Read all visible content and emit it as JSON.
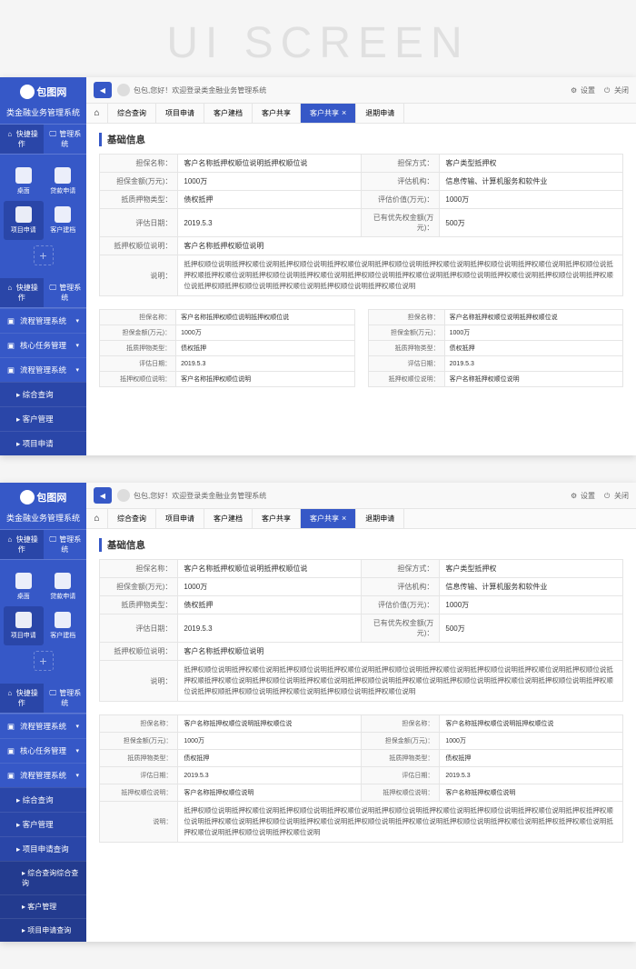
{
  "watermark": "UI SCREEN",
  "sidebar": {
    "logo_text": "包图网",
    "subtitle": "类金融业务管理系统",
    "tabs": [
      {
        "label": "快捷操作",
        "active": true
      },
      {
        "label": "管理系统",
        "active": false
      }
    ],
    "quick_items": [
      {
        "label": "桌面"
      },
      {
        "label": "贷款申请"
      },
      {
        "label": "项目申请",
        "active": true
      },
      {
        "label": "客户建档"
      }
    ],
    "nav_screen1": [
      {
        "label": "流程管理系统",
        "arrow": "▾"
      },
      {
        "label": "核心任务管理",
        "arrow": "▾"
      },
      {
        "label": "流程管理系统",
        "arrow": "▾",
        "expanded": true
      },
      {
        "label": "综合查询",
        "indented": true
      },
      {
        "label": "客户管理",
        "indented": true
      },
      {
        "label": "项目申请",
        "indented": true
      }
    ],
    "nav_screen2": [
      {
        "label": "流程管理系统",
        "arrow": "▾"
      },
      {
        "label": "核心任务管理",
        "arrow": "▾"
      },
      {
        "label": "流程管理系统",
        "arrow": "▾",
        "expanded": true
      },
      {
        "label": "综合查询",
        "indented": true
      },
      {
        "label": "客户管理",
        "indented": true
      },
      {
        "label": "项目申请查询",
        "indented": true
      },
      {
        "label": "综合查询综合查询",
        "sub_indented": true
      },
      {
        "label": "客户管理",
        "sub_indented": true
      },
      {
        "label": "项目申请查询",
        "sub_indented": true
      }
    ]
  },
  "topbar": {
    "welcome": "包包,您好！欢迎登录类金融业务管理系统",
    "settings": "设置",
    "close": "关闭"
  },
  "tabs": [
    {
      "label": "综合查询"
    },
    {
      "label": "项目申请"
    },
    {
      "label": "客户建档"
    },
    {
      "label": "客户共享"
    },
    {
      "label": "客户共享",
      "active": true,
      "closable": true
    },
    {
      "label": "退期申请"
    }
  ],
  "section": {
    "title": "基础信息",
    "rows": [
      {
        "l1": "担保名称：",
        "v1": "客户名称抵押权顺位说明抵押权顺位说",
        "l2": "担保方式：",
        "v2": "客户类型抵押权"
      },
      {
        "l1": "担保金额(万元)：",
        "v1": "1000万",
        "l2": "评估机构：",
        "v2": "信息传输、计算机服务和软件业"
      },
      {
        "l1": "抵质押物类型：",
        "v1": "债权抵押",
        "l2": "评估价值(万元)：",
        "v2": "1000万"
      },
      {
        "l1": "评估日期：",
        "v1": "2019.5.3",
        "l2": "已有优先权金额(万元)：",
        "v2": "500万"
      },
      {
        "l1": "抵押权顺位说明：",
        "v1": "客户名称抵押权顺位说明",
        "l2": "",
        "v2": ""
      }
    ],
    "desc_label": "说明：",
    "desc_text": "抵押权顺位说明抵押权顺位说明抵押权顺位说明抵押权顺位说明抵押权顺位说明抵押权顺位说明抵押权顺位说明抵押权顺位说明抵押权顺位说抵押权顺抵押权顺位说明抵押权顺位说明抵押权顺位说明抵押权顺位说明抵押权顺位说明抵押权顺位说明抵押权顺位说明抵押权顺位说明抵押权顺位说抵押权顺抵押权顺位说明抵押权顺位说明抵押权顺位说明抵押权顺位说明"
  },
  "mini_tables": [
    {
      "rows": [
        {
          "l": "担保名称：",
          "v": "客户名称抵押权顺位说明抵押权顺位说"
        },
        {
          "l": "担保金额(万元)：",
          "v": "1000万"
        },
        {
          "l": "抵质押物类型：",
          "v": "债权抵押"
        },
        {
          "l": "评估日期：",
          "v": "2019.5.3"
        },
        {
          "l": "抵押权顺位说明：",
          "v": "客户名称抵押权顺位说明"
        }
      ]
    },
    {
      "rows": [
        {
          "l": "担保名称：",
          "v": "客户名称抵押权顺位说明抵押权顺位说"
        },
        {
          "l": "担保金额(万元)：",
          "v": "1000万"
        },
        {
          "l": "抵质押物类型：",
          "v": "债权抵押"
        },
        {
          "l": "评估日期：",
          "v": "2019.5.3"
        },
        {
          "l": "抵押权顺位说明：",
          "v": "客户名称抵押权顺位说明"
        }
      ]
    }
  ],
  "screen2_section": {
    "title": "基础信息",
    "rows": [
      {
        "l1": "担保名称：",
        "v1": "客户名称抵押权顺位说明抵押权顺位说",
        "l2": "担保方式：",
        "v2": "客户类型抵押权"
      },
      {
        "l1": "担保金额(万元)：",
        "v1": "1000万",
        "l2": "评估机构：",
        "v2": "信息传输、计算机服务和软件业"
      },
      {
        "l1": "抵质押物类型：",
        "v1": "债权抵押",
        "l2": "评估价值(万元)：",
        "v2": "1000万"
      },
      {
        "l1": "评估日期：",
        "v1": "2019.5.3",
        "l2": "已有优先权金额(万元)：",
        "v2": "500万"
      },
      {
        "l1": "抵押权顺位说明：",
        "v1": "客户名称抵押权顺位说明",
        "l2": "",
        "v2": ""
      }
    ],
    "desc_label": "说明：",
    "desc_text": "抵押权顺位说明抵押权顺位说明抵押权顺位说明抵押权顺位说明抵押权顺位说明抵押权顺位说明抵押权顺位说明抵押权顺位说明抵押权顺位说抵押权顺抵押权顺位说明抵押权顺位说明抵押权顺位说明抵押权顺位说明抵押权顺位说明抵押权顺位说明抵押权顺位说明抵押权顺位说明抵押权顺位说抵押权顺抵押权顺位说明抵押权顺位说明抵押权顺位说明抵押权顺位说明"
  },
  "screen2_mini": {
    "rows": [
      {
        "l1": "担保名称：",
        "v1": "客户名称抵押权顺位说明抵押权顺位说",
        "l2": "担保名称：",
        "v2": "客户名称抵押权顺位说明抵押权顺位说"
      },
      {
        "l1": "担保金额(万元)：",
        "v1": "1000万",
        "l2": "担保金额(万元)：",
        "v2": "1000万"
      },
      {
        "l1": "抵质押物类型：",
        "v1": "债权抵押",
        "l2": "抵质押物类型：",
        "v2": "债权抵押"
      },
      {
        "l1": "评估日期：",
        "v1": "2019.5.3",
        "l2": "评估日期：",
        "v2": "2019.5.3"
      },
      {
        "l1": "抵押权顺位说明：",
        "v1": "客户名称抵押权顺位说明",
        "l2": "抵押权顺位说明：",
        "v2": "客户名称抵押权顺位说明"
      }
    ],
    "desc_label": "说明：",
    "desc_text": "抵押权顺位说明抵押权顺位说明抵押权顺位说明抵押权顺位说明抵押权顺位说明抵押权顺位说明抵押权顺位说明抵押权顺位说明抵押权抵押权顺位说明抵押权顺位说明抵押权顺位说明抵押权顺位说明抵押权顺位说明抵押权顺位说明抵押权顺位说明抵押权顺位说明抵押权抵押权顺位说明抵押权顺位说明抵押权顺位说明抵押权顺位说明"
  }
}
